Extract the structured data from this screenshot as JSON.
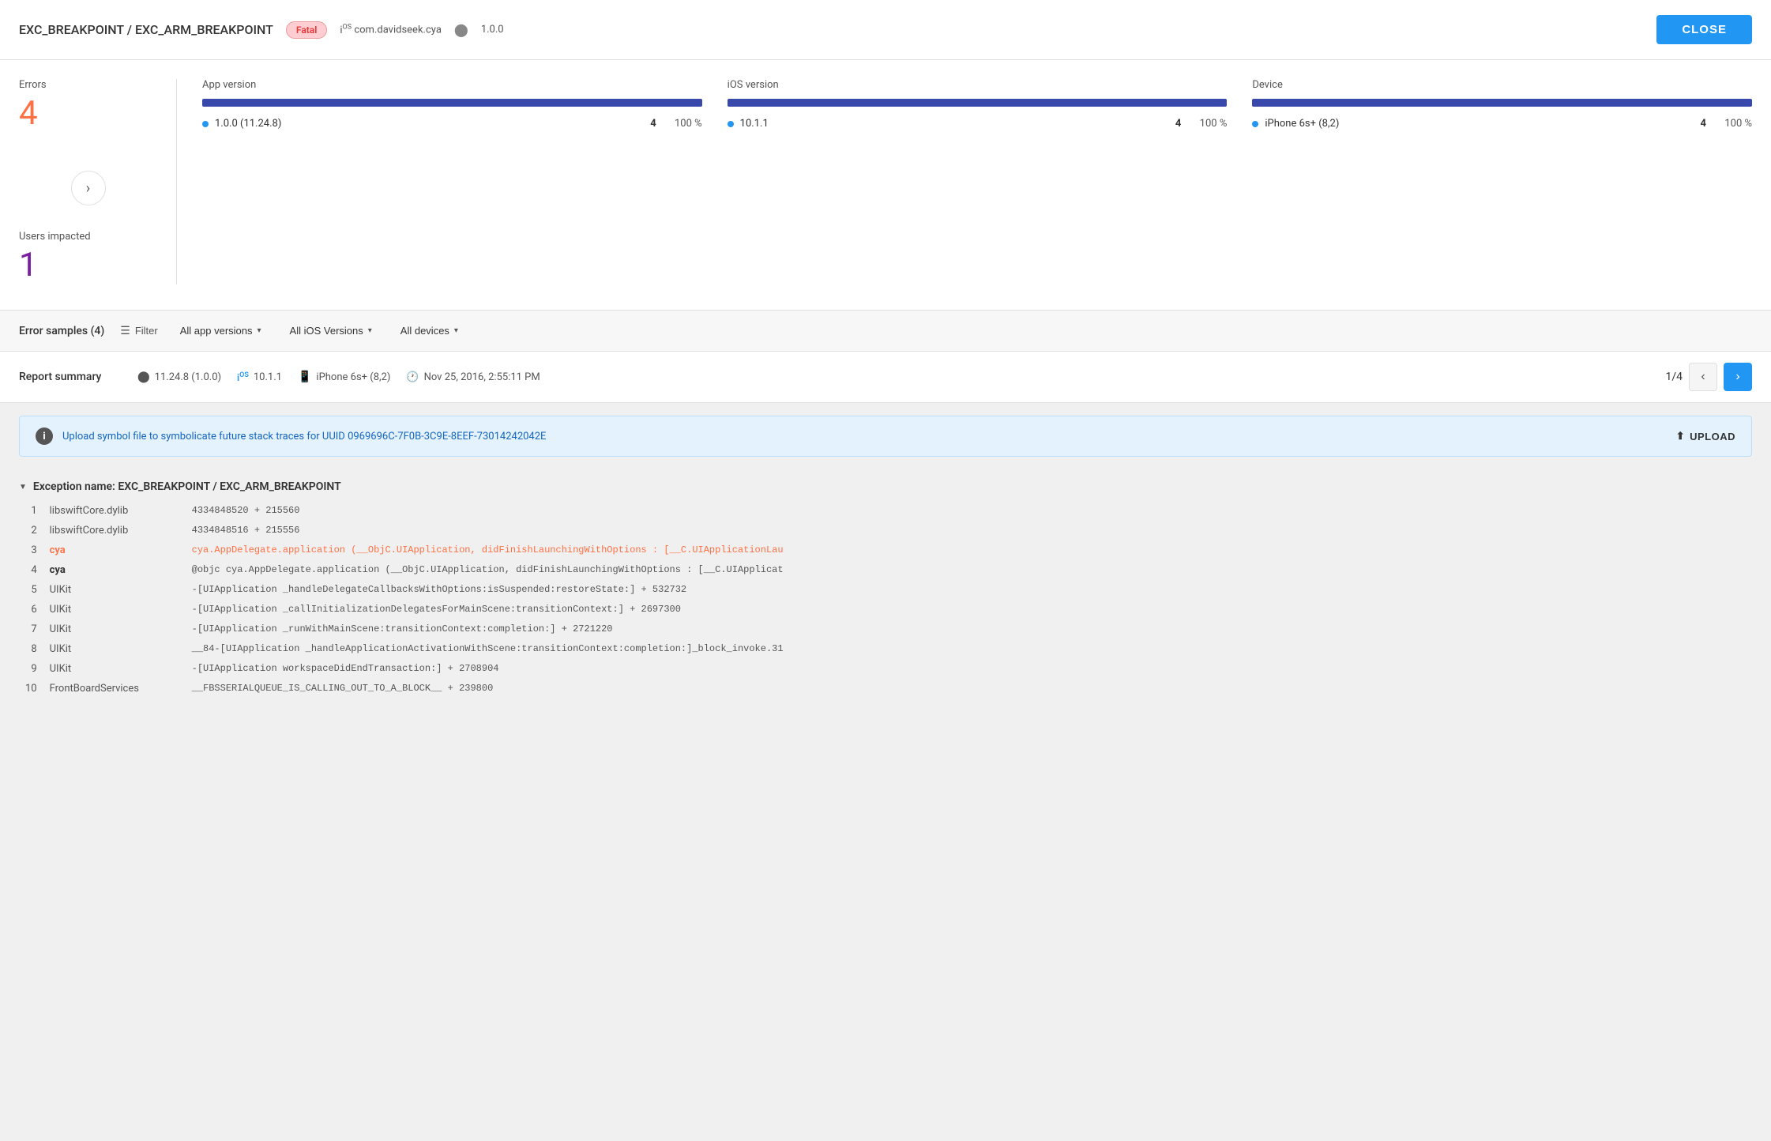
{
  "header": {
    "title": "EXC_BREAKPOINT / EXC_ARM_BREAKPOINT",
    "badge": "Fatal",
    "platform": "iOS",
    "bundle_id": "com.davidseek.cya",
    "version": "1.0.0",
    "close_label": "CLOSE"
  },
  "stats": {
    "errors_label": "Errors",
    "errors_value": "4",
    "users_label": "Users impacted",
    "users_value": "1",
    "nav_arrow": "›",
    "app_version": {
      "title": "App version",
      "bar_width": "100%",
      "rows": [
        {
          "version": "1.0.0 (11.24.8)",
          "count": "4",
          "pct": "100 %"
        }
      ]
    },
    "ios_version": {
      "title": "iOS version",
      "bar_width": "100%",
      "rows": [
        {
          "version": "10.1.1",
          "count": "4",
          "pct": "100 %"
        }
      ]
    },
    "device": {
      "title": "Device",
      "bar_width": "100%",
      "rows": [
        {
          "version": "iPhone 6s+ (8,2)",
          "count": "4",
          "pct": "100 %"
        }
      ]
    }
  },
  "filter_bar": {
    "samples_label": "Error samples (4)",
    "filter_label": "Filter",
    "dropdowns": [
      {
        "label": "All app versions"
      },
      {
        "label": "All iOS Versions"
      },
      {
        "label": "All devices"
      }
    ]
  },
  "report_summary": {
    "label": "Report summary",
    "build": "11.24.8 (1.0.0)",
    "ios_version": "10.1.1",
    "device": "iPhone 6s+ (8,2)",
    "timestamp": "Nov 25, 2016, 2:55:11 PM",
    "page_current": "1",
    "page_total": "4"
  },
  "info_banner": {
    "text": "Upload symbol file to symbolicate future stack traces for UUID 0969696C-7F0B-3C9E-8EEF-73014242042E",
    "upload_label": "UPLOAD"
  },
  "exception": {
    "header": "Exception name: EXC_BREAKPOINT / EXC_ARM_BREAKPOINT",
    "rows": [
      {
        "num": "1",
        "lib": "libswiftCore.dylib",
        "detail": "4334848520 + 215560",
        "highlight": false,
        "bold": false
      },
      {
        "num": "2",
        "lib": "libswiftCore.dylib",
        "detail": "4334848516 + 215556",
        "highlight": false,
        "bold": false
      },
      {
        "num": "3",
        "lib": "cya",
        "detail": "cya.AppDelegate.application (__ObjC.UIApplication, didFinishLaunchingWithOptions : [__C.UIApplicationLau",
        "highlight": true,
        "bold": false
      },
      {
        "num": "4",
        "lib": "cya",
        "detail": "@objc cya.AppDelegate.application (__ObjC.UIApplication, didFinishLaunchingWithOptions : [__C.UIApplicat",
        "highlight": false,
        "bold": true
      },
      {
        "num": "5",
        "lib": "UIKit",
        "detail": "-[UIApplication _handleDelegateCallbacksWithOptions:isSuspended:restoreState:] + 532732",
        "highlight": false,
        "bold": false
      },
      {
        "num": "6",
        "lib": "UIKit",
        "detail": "-[UIApplication _callInitializationDelegatesForMainScene:transitionContext:] + 2697300",
        "highlight": false,
        "bold": false
      },
      {
        "num": "7",
        "lib": "UIKit",
        "detail": "-[UIApplication _runWithMainScene:transitionContext:completion:] + 2721220",
        "highlight": false,
        "bold": false
      },
      {
        "num": "8",
        "lib": "UIKit",
        "detail": "__84-[UIApplication _handleApplicationActivationWithScene:transitionContext:completion:]_block_invoke.31",
        "highlight": false,
        "bold": false
      },
      {
        "num": "9",
        "lib": "UIKit",
        "detail": "-[UIApplication workspaceDidEndTransaction:] + 2708904",
        "highlight": false,
        "bold": false
      },
      {
        "num": "10",
        "lib": "FrontBoardServices",
        "detail": "__FBSSERIALQUEUE_IS_CALLING_OUT_TO_A_BLOCK__ + 239800",
        "highlight": false,
        "bold": false
      }
    ]
  }
}
